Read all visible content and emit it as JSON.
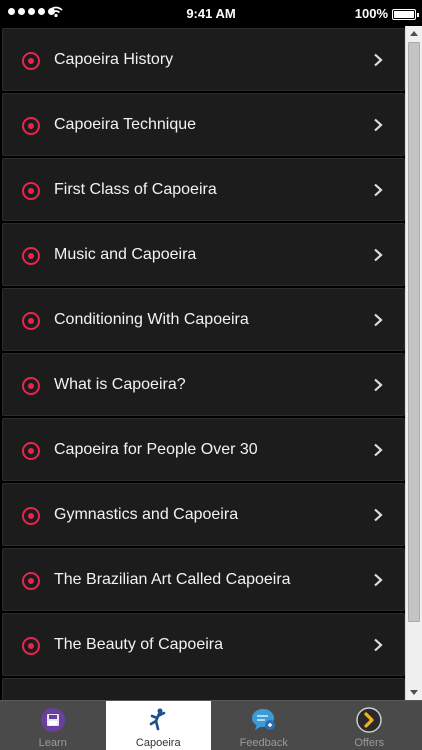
{
  "status_bar": {
    "time": "9:41 AM",
    "battery": "100%"
  },
  "list": {
    "items": [
      {
        "label": "Capoeira History"
      },
      {
        "label": "Capoeira Technique"
      },
      {
        "label": "First Class of Capoeira"
      },
      {
        "label": "Music and Capoeira"
      },
      {
        "label": "Conditioning With Capoeira"
      },
      {
        "label": "What is Capoeira?"
      },
      {
        "label": "Capoeira for People Over 30"
      },
      {
        "label": "Gymnastics and Capoeira"
      },
      {
        "label": "The Brazilian Art Called Capoeira"
      },
      {
        "label": "The Beauty of Capoeira"
      },
      {
        "label": ""
      }
    ],
    "accent_color": "#e5264f"
  },
  "tab_bar": {
    "tabs": [
      {
        "label": "Learn",
        "icon": "save-icon"
      },
      {
        "label": "Capoeira",
        "icon": "martial-arts-icon",
        "active": true
      },
      {
        "label": "Feedback",
        "icon": "chat-bubble-icon"
      },
      {
        "label": "Offers",
        "icon": "chevron-circle-icon"
      }
    ]
  }
}
